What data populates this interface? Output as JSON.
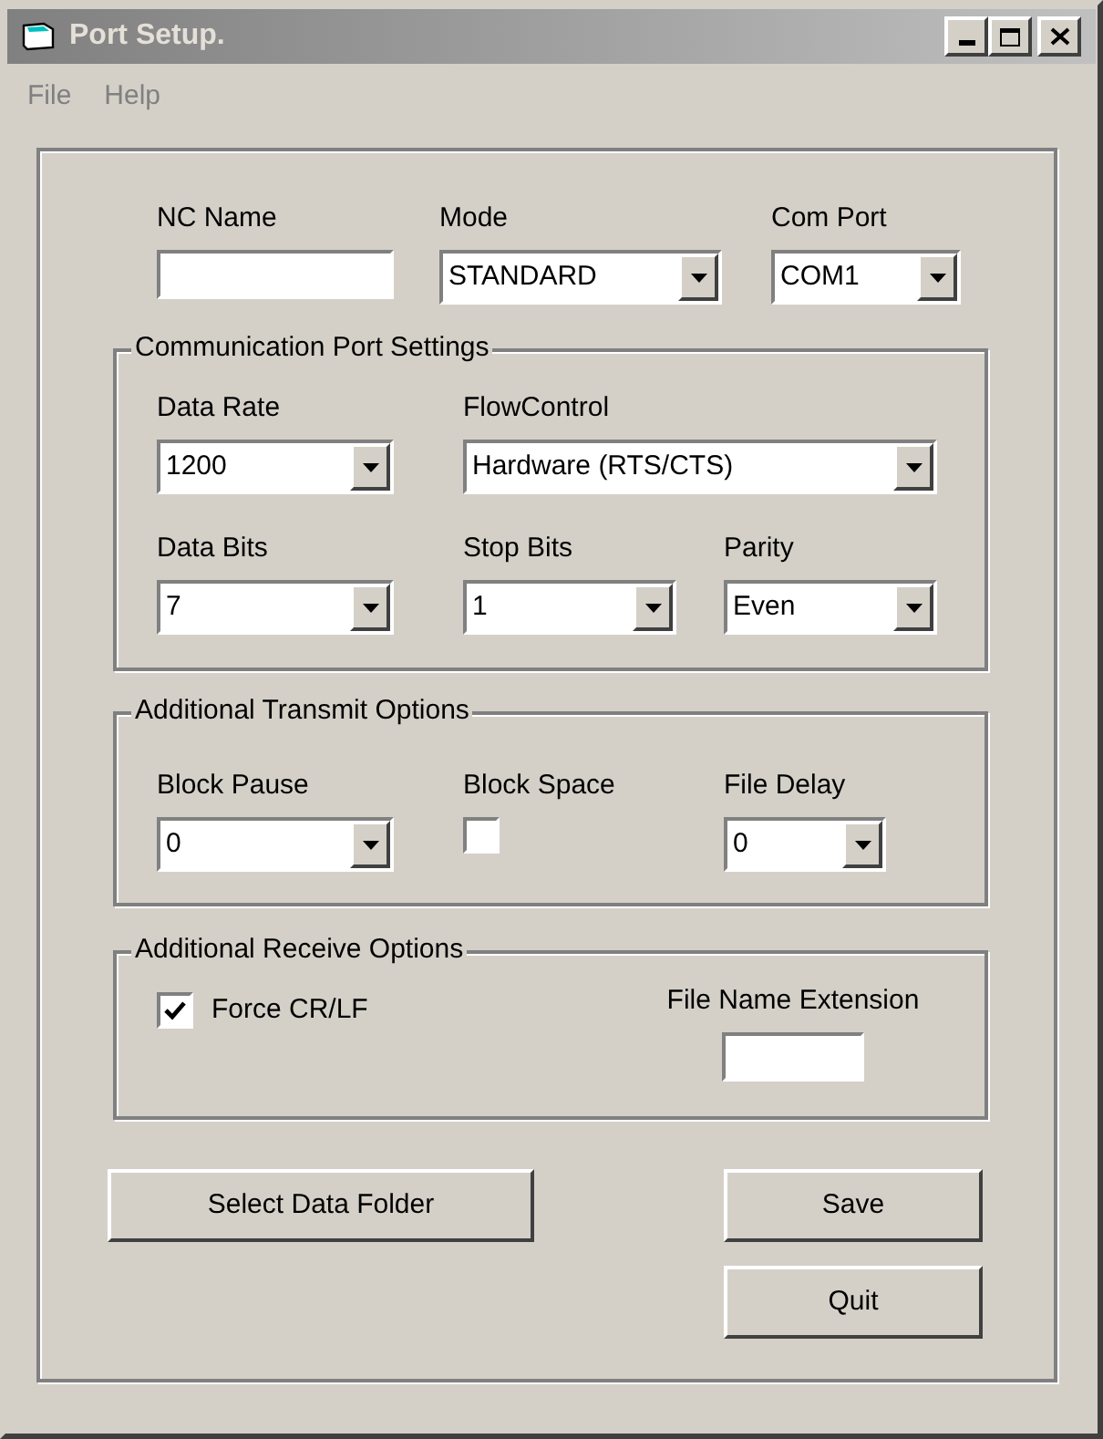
{
  "window": {
    "title": "Port Setup."
  },
  "menu": [
    {
      "label": "File",
      "disabled": true
    },
    {
      "label": "Help",
      "disabled": true
    }
  ],
  "top_fields": [
    {
      "kind": "text",
      "label": "NC Name"
    },
    {
      "kind": "combo",
      "label": "Mode",
      "value": "STANDARD"
    },
    {
      "kind": "combo",
      "label": "Com Port",
      "value": "COM1"
    }
  ],
  "groups": [
    {
      "title": "Communication Port Settings",
      "rows": [
        [
          {
            "kind": "combo",
            "label": "Data Rate",
            "value": "1200"
          },
          {
            "kind": "combo",
            "label": "FlowControl",
            "value": "Hardware (RTS/CTS)"
          }
        ],
        [
          {
            "kind": "combo",
            "label": "Data Bits",
            "value": "7"
          },
          {
            "kind": "combo",
            "label": "Stop Bits",
            "value": "1"
          },
          {
            "kind": "combo",
            "label": "Parity",
            "value": "Even"
          }
        ]
      ]
    },
    {
      "title": "Additional Transmit Options",
      "rows": [
        [
          {
            "kind": "combo",
            "label": "Block Pause",
            "value": "0"
          },
          {
            "kind": "checkbox",
            "label": "Block Space",
            "checked": false
          },
          {
            "kind": "combo",
            "label": "File Delay",
            "value": "0"
          }
        ]
      ]
    },
    {
      "title": "Additional Receive Options",
      "rows": [
        [
          {
            "kind": "inline_checkbox",
            "label": "Force CR/LF",
            "checked": true
          },
          {
            "kind": "text",
            "label": "File Name Extension"
          }
        ]
      ]
    }
  ],
  "buttons": [
    {
      "label": "Select Data Folder"
    },
    {
      "label": "Save"
    },
    {
      "label": "Quit"
    }
  ]
}
